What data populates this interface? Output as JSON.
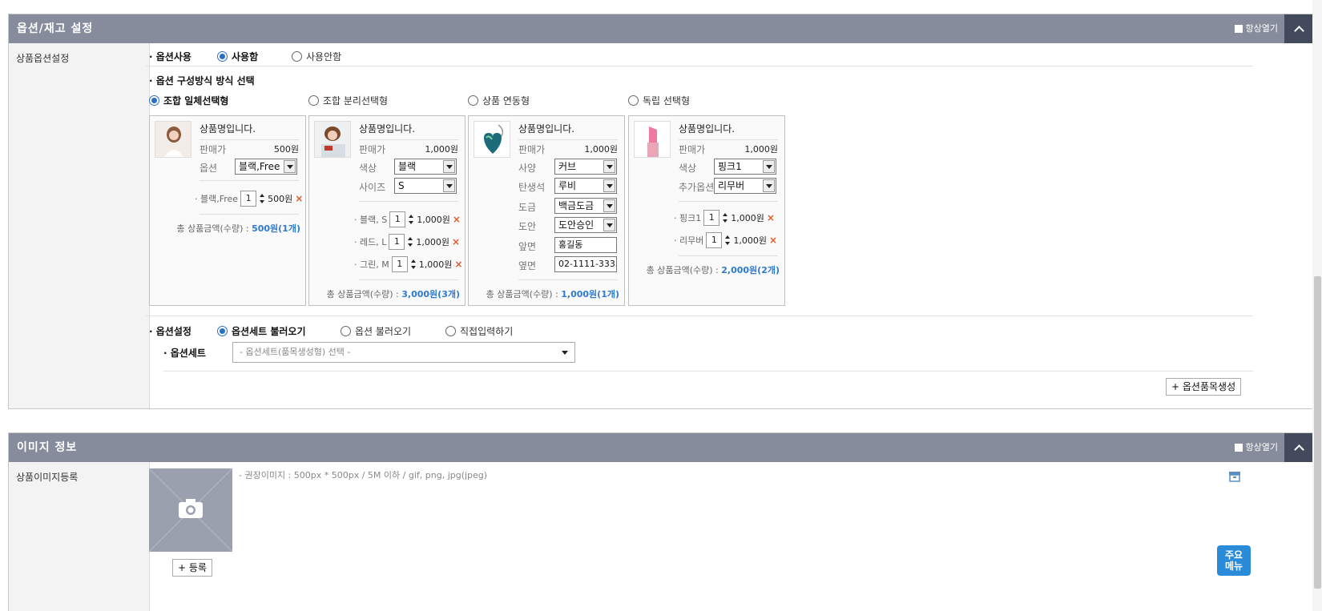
{
  "option_panel": {
    "title": "옵션/재고 설정",
    "always_open": "항상열기",
    "row_label": "상품옵션설정",
    "option_use": {
      "label": "옵션사용",
      "use": "사용함",
      "not_use": "사용안함"
    },
    "composition": {
      "label": "옵션 구성방식 방식 선택",
      "types": [
        "조합 일체선택형",
        "조합 분리선택형",
        "상품 연동형",
        "독립 선택형"
      ]
    },
    "cards": [
      {
        "name": "상품명입니다.",
        "price_label": "판매가",
        "price": "500원",
        "fields": [
          {
            "label": "옵션",
            "value": "블랙,Free"
          }
        ],
        "items": [
          {
            "label": "블랙,Free",
            "qty": "1",
            "price": "500원"
          }
        ],
        "total_label": "총 상품금액(수량) :",
        "total_value": "500원(1개)"
      },
      {
        "name": "상품명입니다.",
        "price_label": "판매가",
        "price": "1,000원",
        "fields": [
          {
            "label": "색상",
            "value": "블랙"
          },
          {
            "label": "사이즈",
            "value": "S"
          }
        ],
        "items": [
          {
            "label": "블랙, S",
            "qty": "1",
            "price": "1,000원"
          },
          {
            "label": "레드, L",
            "qty": "1",
            "price": "1,000원"
          },
          {
            "label": "그린, M",
            "qty": "1",
            "price": "1,000원"
          }
        ],
        "total_label": "총 상품금액(수량) :",
        "total_value": "3,000원(3개)"
      },
      {
        "name": "상품명입니다.",
        "price_label": "판매가",
        "price": "1,000원",
        "fields": [
          {
            "label": "사양",
            "value": "커브"
          },
          {
            "label": "탄생석",
            "value": "루비"
          },
          {
            "label": "도금",
            "value": "백금도금"
          },
          {
            "label": "도안",
            "value": "도안승인"
          },
          {
            "label": "앞면",
            "value": "홍길동"
          },
          {
            "label": "옆면",
            "value": "02-1111-3333"
          }
        ],
        "items": [],
        "total_label": "총 상품금액(수량) :",
        "total_value": "1,000원(1개)"
      },
      {
        "name": "상품명입니다.",
        "price_label": "판매가",
        "price": "1,000원",
        "fields": [
          {
            "label": "색상",
            "value": "핑크1"
          },
          {
            "label": "추가옵션",
            "value": "리무버"
          }
        ],
        "items": [
          {
            "label": "핑크1",
            "qty": "1",
            "price": "1,000원"
          },
          {
            "label": "리무버",
            "qty": "1",
            "price": "1,000원"
          }
        ],
        "total_label": "총 상품금액(수량) :",
        "total_value": "2,000원(2개)"
      }
    ],
    "option_setting": {
      "label": "옵션설정",
      "choices": [
        "옵션세트 불러오기",
        "옵션 불러오기",
        "직접입력하기"
      ]
    },
    "option_set": {
      "label": "옵션세트",
      "placeholder": "- 옵션세트(품목생성형) 선택 -"
    },
    "create_button": "+ 옵션품목생성"
  },
  "image_panel": {
    "title": "이미지 정보",
    "always_open": "항상열기",
    "row_label": "상품이미지등록",
    "hint": "- 권장이미지 : 500px * 500px / 5M 이하 / gif, png, jpg(jpeg)",
    "register_button": "+ 등록"
  },
  "main_menu": {
    "line1": "주요",
    "line2": "메뉴"
  },
  "colors": {
    "header_bg": "#878c9c",
    "header_dark": "#434a5c",
    "accent_blue": "#2e7bd0",
    "delete_orange": "#e05a2b"
  }
}
